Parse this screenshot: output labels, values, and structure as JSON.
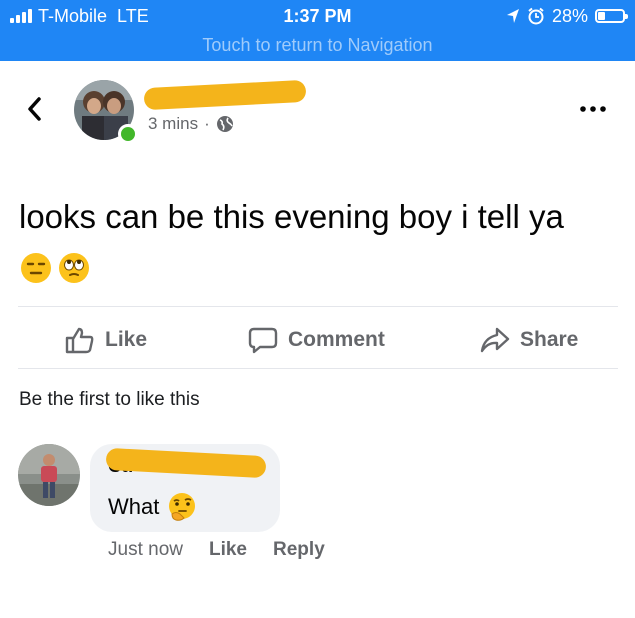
{
  "status_bar": {
    "carrier": "T-Mobile",
    "network": "LTE",
    "time": "1:37 PM",
    "battery": "28%",
    "battery_level": 0.28,
    "return_text": "Touch to return to Navigation"
  },
  "post": {
    "time_ago": "3 mins",
    "separator": "·",
    "text": "looks can be this evening boy i tell ya"
  },
  "actions": {
    "like": "Like",
    "comment": "Comment",
    "share": "Share"
  },
  "reactions_summary": "Be the first to like this",
  "comment": {
    "author_partial": "Ca",
    "text": "What",
    "time": "Just now",
    "like": "Like",
    "reply": "Reply"
  },
  "colors": {
    "status_bar": "#1f86f5",
    "redaction": "#f4b41b",
    "online": "#42b72a",
    "bubble": "#f0f2f5",
    "muted": "#65676b"
  }
}
